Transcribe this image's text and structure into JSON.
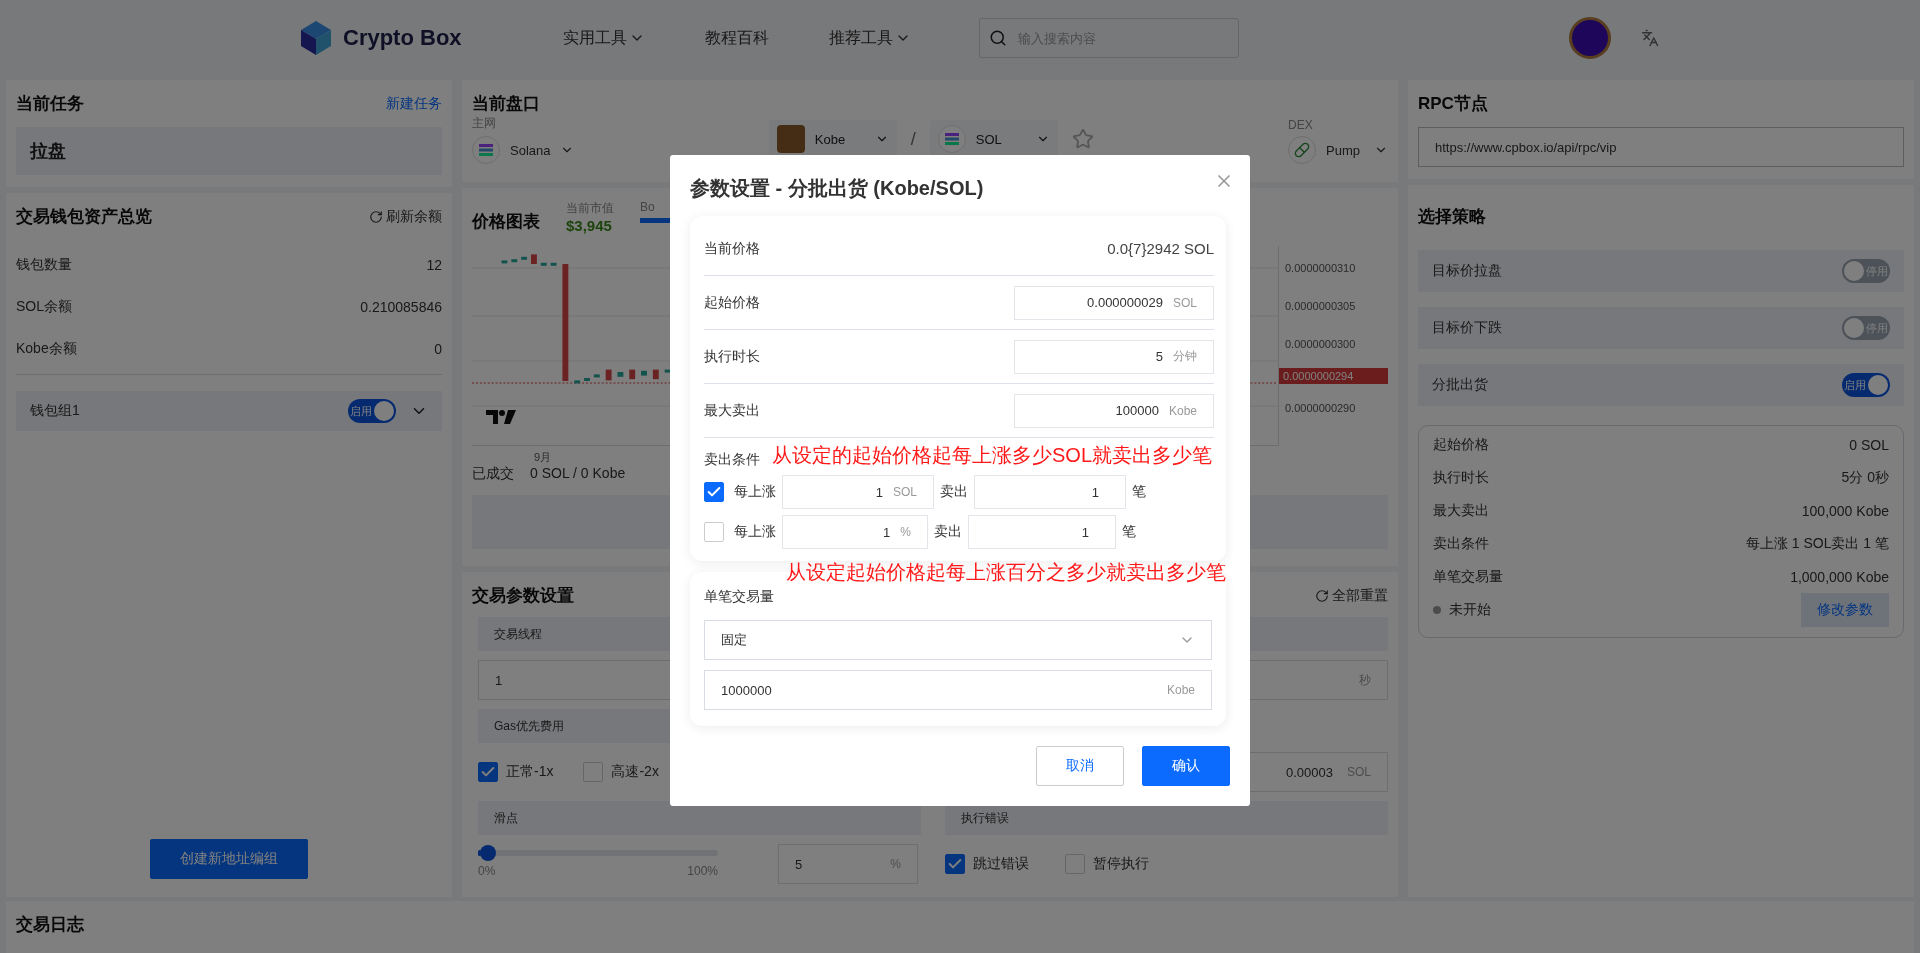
{
  "header": {
    "logo_text": "Crypto Box",
    "nav": [
      {
        "label": "实用工具",
        "dropdown": true
      },
      {
        "label": "教程百科",
        "dropdown": false
      },
      {
        "label": "推荐工具",
        "dropdown": true
      }
    ],
    "search": {
      "placeholder": "输入搜索内容"
    }
  },
  "task_panel": {
    "title": "当前任务",
    "link": "新建任务",
    "current": "拉盘"
  },
  "wallet_panel": {
    "title": "交易钱包资产总览",
    "refresh": "刷新余额",
    "rows": [
      {
        "label": "钱包数量",
        "value": "12"
      },
      {
        "label": "SOL余额",
        "value": "0.210085846"
      },
      {
        "label": "Kobe余额",
        "value": "0"
      }
    ],
    "groups": [
      {
        "name": "钱包组1",
        "toggle_label": "启用",
        "on": true
      }
    ],
    "create_button": "创建新地址编组"
  },
  "market_panel": {
    "title": "当前盘口",
    "network_label": "主网",
    "network": "Solana",
    "base_token": "Kobe",
    "separator": "/",
    "quote_token": "SOL",
    "dex_label": "DEX",
    "dex": "Pump"
  },
  "chart_panel": {
    "title": "价格图表",
    "market_cap_label": "当前市值",
    "market_cap": "$3,945",
    "cut_label": "Bo",
    "price_axis": [
      "0.0000000310",
      "0.0000000305",
      "0.0000000300",
      "0.0000000290"
    ],
    "current_price": "0.0000000294",
    "x_label": "9月",
    "filled_label": "已成交",
    "filled_value": "0 SOL / 0 Kobe"
  },
  "params_panel": {
    "title": "交易参数设置",
    "reset": "全部重置",
    "threads": {
      "label": "交易线程",
      "value": "1"
    },
    "interval_unit": "秒",
    "gas": {
      "label": "Gas优先费用",
      "options": [
        {
          "label": "正常-1x",
          "checked": true
        },
        {
          "label": "高速-2x",
          "checked": false
        }
      ],
      "value": "0.00003",
      "unit": "SOL"
    },
    "slippage": {
      "label": "滑点",
      "level": 0.04,
      "min": "0%",
      "max": "100%",
      "value": "5",
      "unit": "%"
    },
    "error": {
      "label": "执行错误",
      "options": [
        {
          "label": "跳过错误",
          "checked": true
        },
        {
          "label": "暂停执行",
          "checked": false
        }
      ]
    }
  },
  "rpc_panel": {
    "title": "RPC节点",
    "value": "https://www.cpbox.io/api/rpc/vip"
  },
  "strategy_panel": {
    "title": "选择策略",
    "strategies": [
      {
        "name": "目标价拉盘",
        "toggle_label": "停用",
        "on": false
      },
      {
        "name": "目标价下跌",
        "toggle_label": "停用",
        "on": false
      },
      {
        "name": "分批出货",
        "toggle_label": "启用",
        "on": true
      }
    ],
    "summary": [
      {
        "label": "起始价格",
        "value": "0 SOL"
      },
      {
        "label": "执行时长",
        "value": "5分 0秒"
      },
      {
        "label": "最大卖出",
        "value": "100,000 Kobe"
      },
      {
        "label": "卖出条件",
        "value": "每上涨 1 SOL卖出 1 笔"
      },
      {
        "label": "单笔交易量",
        "value": "1,000,000 Kobe"
      }
    ],
    "status": "未开始",
    "edit_button": "修改参数"
  },
  "log_panel": {
    "title": "交易日志"
  },
  "dialog": {
    "title": "参数设置 - 分批出货 (Kobe/SOL)",
    "rows": [
      {
        "kind": "text",
        "label": "当前价格",
        "value": "0.0{7}2942 SOL"
      },
      {
        "kind": "input",
        "label": "起始价格",
        "value": "0.000000029",
        "unit": "SOL"
      },
      {
        "kind": "input",
        "label": "执行时长",
        "value": "5",
        "unit": "分钟"
      },
      {
        "kind": "input",
        "label": "最大卖出",
        "value": "100000",
        "unit": "Kobe"
      }
    ],
    "conditions_label": "卖出条件",
    "conditions": [
      {
        "checked": true,
        "prefix": "每上涨",
        "amount": "1",
        "unit": "SOL",
        "sell_label": "卖出",
        "count": "1",
        "count_unit": "笔"
      },
      {
        "checked": false,
        "prefix": "每上涨",
        "amount": "1",
        "unit": "%",
        "sell_label": "卖出",
        "count": "1",
        "count_unit": "笔"
      }
    ],
    "size_label": "单笔交易量",
    "size_mode": "固定",
    "size_value": "1000000",
    "size_unit": "Kobe",
    "cancel": "取消",
    "confirm": "确认"
  },
  "annotations": [
    "从设定的起始价格起每上涨多少SOL就卖出多少笔",
    "从设定起始价格起每上涨百分之多少就卖出多少笔"
  ]
}
